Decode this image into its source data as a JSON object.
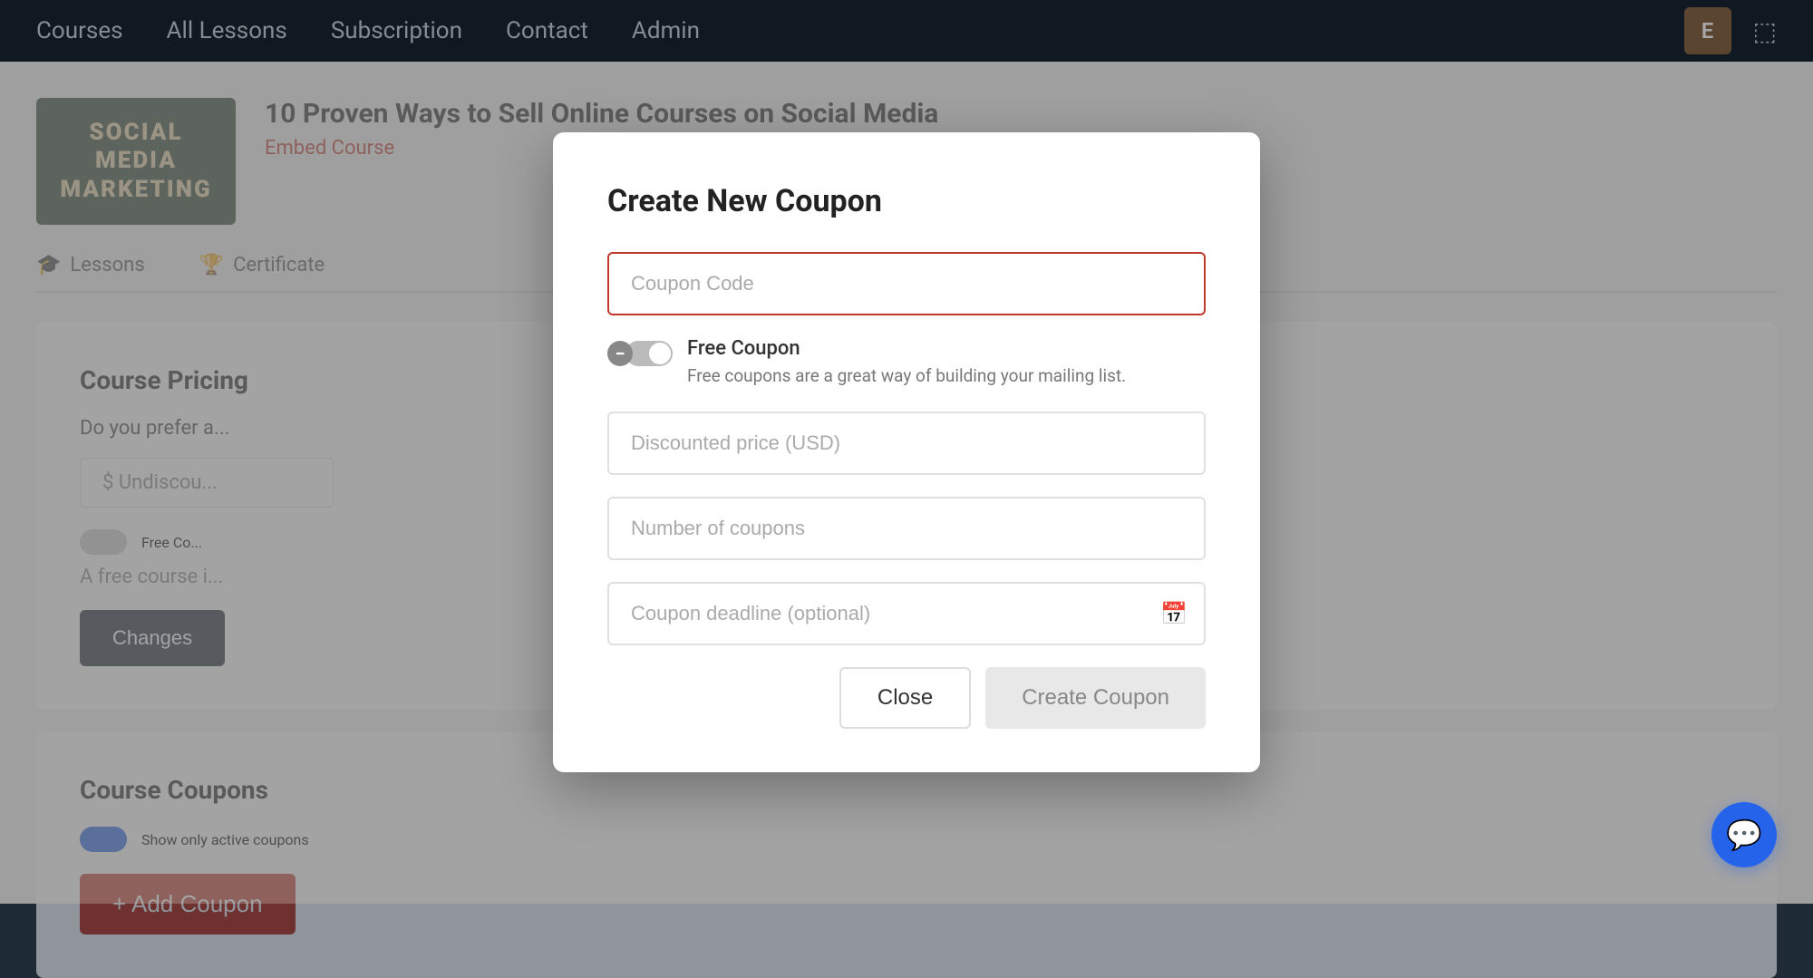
{
  "nav": {
    "links": [
      "Courses",
      "All Lessons",
      "Subscription",
      "Contact",
      "Admin"
    ],
    "avatar_letter": "E"
  },
  "course": {
    "thumb_line1": "SOCIAL",
    "thumb_line2": "MEDIA",
    "thumb_line3": "MARKETING",
    "title": "10 Proven Ways to Sell Online Courses on Social Media",
    "embed_label": "Embed Course"
  },
  "tabs": [
    {
      "label": "Lessons",
      "icon": "🎓"
    },
    {
      "label": "Certificate",
      "icon": "🏆"
    }
  ],
  "pricing_section": {
    "title": "Course Pricing",
    "subtitle": "Do you prefer a...",
    "price_placeholder": "$ Undiscou...",
    "free_coupon_label": "Free Co...",
    "free_coupon_desc": "A free course i...",
    "save_label": "Changes"
  },
  "coupons_section": {
    "title": "Course Coupons",
    "show_active_label": "Show only active coupons",
    "add_coupon_label": "+ Add Coupon"
  },
  "modal": {
    "title": "Create New Coupon",
    "coupon_code_placeholder": "Coupon Code",
    "free_coupon_label": "Free Coupon",
    "free_coupon_desc": "Free coupons are a great way of building your mailing list.",
    "discounted_price_placeholder": "Discounted price (USD)",
    "num_coupons_placeholder": "Number of coupons",
    "deadline_placeholder": "Coupon deadline (optional)",
    "close_label": "Close",
    "create_label": "Create Coupon"
  }
}
